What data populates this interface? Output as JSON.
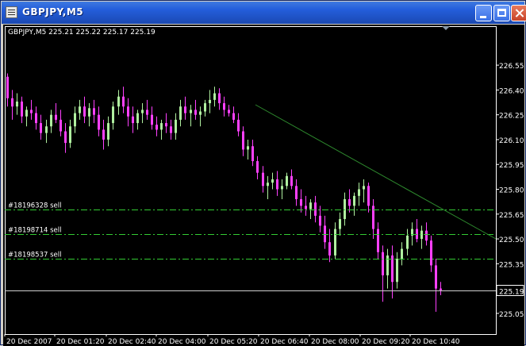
{
  "window": {
    "title": "GBPJPY,M5",
    "icon": "chart-window-icon",
    "buttons": {
      "minimize": "minimize-icon",
      "maximize": "maximize-icon",
      "close": "close-icon"
    }
  },
  "chart": {
    "header_text": "GBPJPY,M5  225.21 225.22 225.17 225.19",
    "current_price": "225.19",
    "colors": {
      "background": "#000000",
      "frame": "#ffffff",
      "bull_candle": "#b0f0a0",
      "bear_candle": "#ff40ff",
      "order_lines": "#33cc33",
      "trendline": "#2e8b2e",
      "text": "#ffffff"
    },
    "orders": [
      {
        "label": "#18196328 sell",
        "price": 225.68
      },
      {
        "label": "#18198714 sell",
        "price": 225.53
      },
      {
        "label": "#18198537 sell",
        "price": 225.38
      }
    ]
  },
  "chart_data": {
    "type": "candlestick",
    "title": "GBPJPY,M5",
    "y_ticks": [
      "226.55",
      "226.40",
      "226.25",
      "226.10",
      "225.95",
      "225.80",
      "225.65",
      "225.50",
      "225.35",
      "225.05"
    ],
    "x_ticks": [
      "20 Dec 2007",
      "20 Dec 01:20",
      "20 Dec 02:40",
      "20 Dec 04:00",
      "20 Dec 05:20",
      "20 Dec 06:40",
      "20 Dec 08:00",
      "20 Dec 09:20",
      "20 Dec 10:40"
    ],
    "ylim": [
      224.98,
      226.62
    ],
    "ohlc": [
      [
        226.48,
        226.5,
        226.3,
        226.35
      ],
      [
        226.35,
        226.4,
        226.22,
        226.3
      ],
      [
        226.3,
        226.38,
        226.25,
        226.33
      ],
      [
        226.33,
        226.36,
        226.2,
        226.24
      ],
      [
        226.24,
        226.3,
        226.18,
        226.28
      ],
      [
        226.28,
        226.34,
        226.22,
        226.26
      ],
      [
        226.26,
        226.3,
        226.16,
        226.2
      ],
      [
        226.2,
        226.25,
        226.1,
        226.14
      ],
      [
        226.14,
        226.22,
        226.08,
        226.18
      ],
      [
        226.18,
        226.28,
        226.14,
        226.25
      ],
      [
        226.25,
        226.32,
        226.2,
        226.22
      ],
      [
        226.22,
        226.28,
        226.12,
        226.15
      ],
      [
        226.15,
        226.2,
        226.02,
        226.08
      ],
      [
        226.08,
        226.22,
        226.05,
        226.18
      ],
      [
        226.18,
        226.3,
        226.14,
        226.26
      ],
      [
        226.26,
        226.34,
        226.22,
        226.3
      ],
      [
        226.3,
        226.36,
        226.2,
        226.24
      ],
      [
        226.24,
        226.32,
        226.18,
        226.29
      ],
      [
        226.29,
        226.34,
        226.2,
        226.25
      ],
      [
        226.25,
        226.3,
        226.12,
        226.16
      ],
      [
        226.16,
        226.22,
        226.04,
        226.1
      ],
      [
        226.1,
        226.24,
        226.06,
        226.2
      ],
      [
        226.2,
        226.33,
        226.16,
        226.3
      ],
      [
        226.3,
        226.4,
        226.25,
        226.36
      ],
      [
        226.36,
        226.42,
        226.26,
        226.3
      ],
      [
        226.3,
        226.35,
        226.18,
        226.24
      ],
      [
        226.24,
        226.3,
        226.14,
        226.2
      ],
      [
        226.2,
        226.28,
        226.16,
        226.26
      ],
      [
        226.26,
        226.32,
        226.2,
        226.28
      ],
      [
        226.28,
        226.34,
        226.22,
        226.25
      ],
      [
        226.25,
        226.3,
        226.16,
        226.19
      ],
      [
        226.19,
        226.24,
        226.12,
        226.16
      ],
      [
        226.16,
        226.22,
        226.1,
        226.2
      ],
      [
        226.2,
        226.26,
        226.14,
        226.18
      ],
      [
        226.18,
        226.22,
        226.1,
        226.14
      ],
      [
        226.14,
        226.26,
        226.1,
        226.22
      ],
      [
        226.22,
        226.34,
        226.18,
        226.3
      ],
      [
        226.3,
        226.36,
        226.22,
        226.26
      ],
      [
        226.26,
        226.31,
        226.18,
        226.28
      ],
      [
        226.28,
        226.34,
        226.22,
        226.25
      ],
      [
        226.25,
        226.3,
        226.18,
        226.27
      ],
      [
        226.27,
        226.34,
        226.24,
        226.32
      ],
      [
        226.32,
        226.4,
        226.26,
        226.34
      ],
      [
        226.34,
        226.42,
        226.3,
        226.38
      ],
      [
        226.38,
        226.41,
        226.28,
        226.32
      ],
      [
        226.32,
        226.36,
        226.24,
        226.28
      ],
      [
        226.28,
        226.31,
        226.24,
        226.26
      ],
      [
        226.26,
        226.3,
        226.2,
        226.22
      ],
      [
        226.22,
        226.26,
        226.12,
        226.15
      ],
      [
        226.15,
        226.18,
        226.0,
        226.04
      ],
      [
        226.04,
        226.1,
        225.98,
        226.06
      ],
      [
        226.06,
        226.1,
        225.94,
        225.97
      ],
      [
        225.97,
        226.0,
        225.86,
        225.9
      ],
      [
        225.9,
        225.94,
        225.78,
        225.82
      ],
      [
        225.82,
        225.88,
        225.74,
        225.84
      ],
      [
        225.84,
        225.9,
        225.8,
        225.86
      ],
      [
        225.86,
        225.91,
        225.76,
        225.8
      ],
      [
        225.8,
        225.86,
        225.74,
        225.82
      ],
      [
        225.82,
        225.9,
        225.8,
        225.88
      ],
      [
        225.88,
        225.92,
        225.8,
        225.82
      ],
      [
        225.82,
        225.86,
        225.7,
        225.74
      ],
      [
        225.74,
        225.8,
        225.66,
        225.7
      ],
      [
        225.7,
        225.76,
        225.64,
        225.68
      ],
      [
        225.68,
        225.74,
        225.62,
        225.72
      ],
      [
        225.72,
        225.76,
        225.6,
        225.64
      ],
      [
        225.64,
        225.7,
        225.54,
        225.58
      ],
      [
        225.58,
        225.64,
        225.44,
        225.48
      ],
      [
        225.48,
        225.56,
        225.36,
        225.4
      ],
      [
        225.4,
        225.6,
        225.38,
        225.56
      ],
      [
        225.56,
        225.66,
        225.52,
        225.62
      ],
      [
        225.62,
        225.78,
        225.58,
        225.74
      ],
      [
        225.74,
        225.8,
        225.66,
        225.7
      ],
      [
        225.7,
        225.78,
        225.64,
        225.76
      ],
      [
        225.76,
        225.84,
        225.7,
        225.8
      ],
      [
        225.8,
        225.86,
        225.72,
        225.82
      ],
      [
        225.82,
        225.84,
        225.66,
        225.7
      ],
      [
        225.7,
        225.74,
        225.5,
        225.56
      ],
      [
        225.56,
        225.6,
        225.38,
        225.42
      ],
      [
        225.42,
        225.46,
        225.12,
        225.28
      ],
      [
        225.28,
        225.44,
        225.2,
        225.4
      ],
      [
        225.4,
        225.46,
        225.14,
        225.24
      ],
      [
        225.24,
        225.42,
        225.2,
        225.38
      ],
      [
        225.38,
        225.48,
        225.34,
        225.44
      ],
      [
        225.44,
        225.56,
        225.4,
        225.52
      ],
      [
        225.52,
        225.6,
        225.46,
        225.56
      ],
      [
        225.56,
        225.62,
        225.48,
        225.5
      ],
      [
        225.5,
        225.58,
        225.44,
        225.55
      ],
      [
        225.55,
        225.6,
        225.46,
        225.49
      ],
      [
        225.49,
        225.52,
        225.3,
        225.34
      ],
      [
        225.34,
        225.38,
        225.06,
        225.2
      ],
      [
        225.2,
        225.24,
        225.16,
        225.19
      ]
    ]
  }
}
